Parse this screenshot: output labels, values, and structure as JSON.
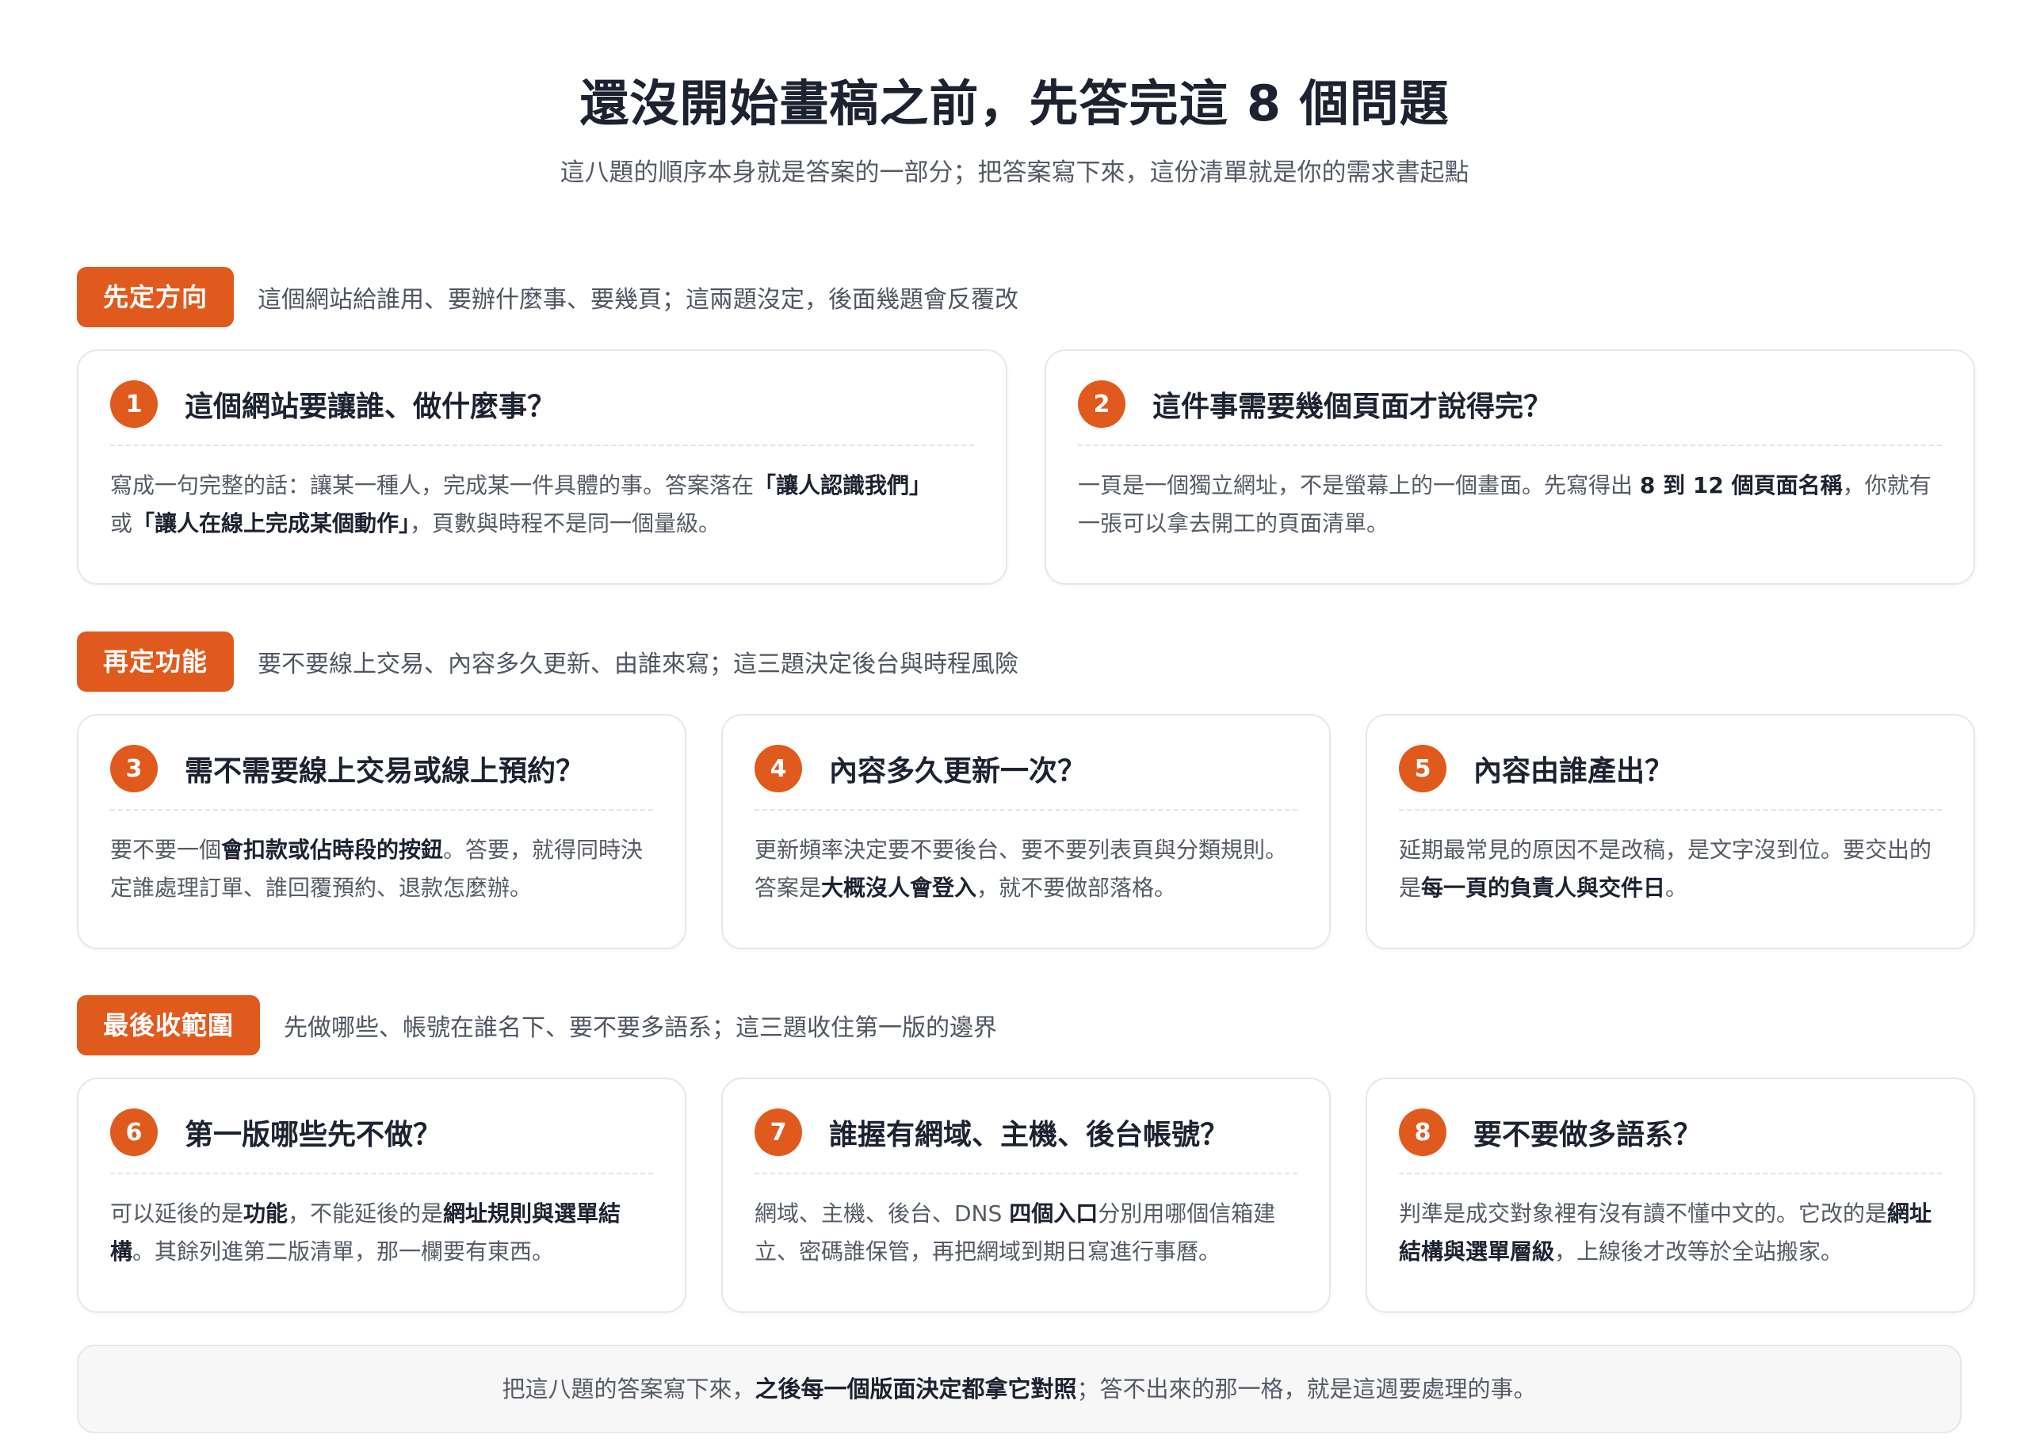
{
  "header": {
    "title": "還沒開始畫稿之前，先答完這 8 個問題",
    "subtitle": "這八題的順序本身就是答案的一部分；把答案寫下來，這份清單就是你的需求書起點"
  },
  "colors": {
    "accent": "#e05a1d",
    "text_dark": "#1c2230",
    "text_muted": "#555b66",
    "card_border": "#e6e7ea",
    "footer_bg": "#f7f7f8"
  },
  "sections": [
    {
      "tag": "先定方向",
      "description": "這個網站給誰用、要辦什麼事、要幾頁；這兩題沒定，後面幾題會反覆改",
      "cards": [
        {
          "number": "1",
          "title": "這個網站要讓誰、做什麼事？",
          "body": [
            {
              "text": "寫成一句完整的話：讓某一種人，完成某一件具體的事。答案落在",
              "bold": false
            },
            {
              "text": "「讓人認識我們」",
              "bold": true
            },
            {
              "text": "或",
              "bold": false
            },
            {
              "text": "「讓人在線上完成某個動作」",
              "bold": true
            },
            {
              "text": "，頁數與時程不是同一個量級。",
              "bold": false
            }
          ]
        },
        {
          "number": "2",
          "title": "這件事需要幾個頁面才說得完？",
          "body": [
            {
              "text": "一頁是一個獨立網址，不是螢幕上的一個畫面。先寫得出 ",
              "bold": false
            },
            {
              "text": "8 到 12 個頁面名稱",
              "bold": true
            },
            {
              "text": "，你就有一張可以拿去開工的頁面清單。",
              "bold": false
            }
          ]
        }
      ]
    },
    {
      "tag": "再定功能",
      "description": "要不要線上交易、內容多久更新、由誰來寫；這三題決定後台與時程風險",
      "cards": [
        {
          "number": "3",
          "title": "需不需要線上交易或線上預約？",
          "body": [
            {
              "text": "要不要一個",
              "bold": false
            },
            {
              "text": "會扣款或佔時段的按鈕",
              "bold": true
            },
            {
              "text": "。答要，就得同時決定誰處理訂單、誰回覆預約、退款怎麼辦。",
              "bold": false
            }
          ]
        },
        {
          "number": "4",
          "title": "內容多久更新一次？",
          "body": [
            {
              "text": "更新頻率決定要不要後台、要不要列表頁與分類規則。答案是",
              "bold": false
            },
            {
              "text": "大概沒人會登入",
              "bold": true
            },
            {
              "text": "，就不要做部落格。",
              "bold": false
            }
          ]
        },
        {
          "number": "5",
          "title": "內容由誰產出？",
          "body": [
            {
              "text": "延期最常見的原因不是改稿，是文字沒到位。要交出的是",
              "bold": false
            },
            {
              "text": "每一頁的負責人與交件日",
              "bold": true
            },
            {
              "text": "。",
              "bold": false
            }
          ]
        }
      ]
    },
    {
      "tag": "最後收範圍",
      "description": "先做哪些、帳號在誰名下、要不要多語系；這三題收住第一版的邊界",
      "cards": [
        {
          "number": "6",
          "title": "第一版哪些先不做？",
          "body": [
            {
              "text": "可以延後的是",
              "bold": false
            },
            {
              "text": "功能",
              "bold": true
            },
            {
              "text": "，不能延後的是",
              "bold": false
            },
            {
              "text": "網址規則與選單結構",
              "bold": true
            },
            {
              "text": "。其餘列進第二版清單，那一欄要有東西。",
              "bold": false
            }
          ]
        },
        {
          "number": "7",
          "title": "誰握有網域、主機、後台帳號？",
          "body": [
            {
              "text": "網域、主機、後台、DNS ",
              "bold": false
            },
            {
              "text": "四個入口",
              "bold": true
            },
            {
              "text": "分別用哪個信箱建立、密碼誰保管，再把網域到期日寫進行事曆。",
              "bold": false
            }
          ]
        },
        {
          "number": "8",
          "title": "要不要做多語系？",
          "body": [
            {
              "text": "判準是成交對象裡有沒有讀不懂中文的。它改的是",
              "bold": false
            },
            {
              "text": "網址結構與選單層級",
              "bold": true
            },
            {
              "text": "，上線後才改等於全站搬家。",
              "bold": false
            }
          ]
        }
      ]
    }
  ],
  "footer": [
    {
      "text": "把這八題的答案寫下來，",
      "bold": false
    },
    {
      "text": "之後每一個版面決定都拿它對照",
      "bold": true
    },
    {
      "text": "；答不出來的那一格，就是這週要處理的事。",
      "bold": false
    }
  ]
}
